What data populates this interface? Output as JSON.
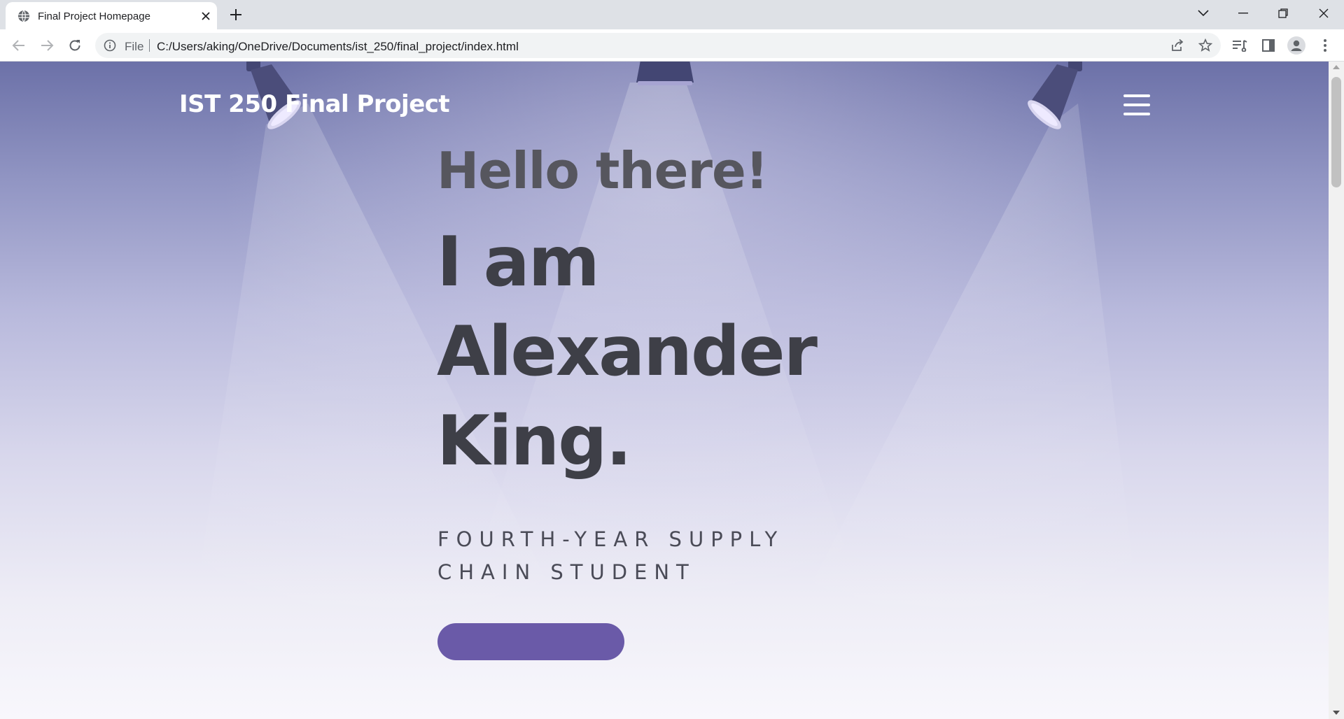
{
  "browser": {
    "tab_title": "Final Project Homepage",
    "omnibox": {
      "scheme_label": "File",
      "url": "C:/Users/aking/OneDrive/Documents/ist_250/final_project/index.html"
    },
    "icons": {
      "tab_favicon": "globe-icon",
      "tab_close": "close-icon",
      "new_tab": "plus-icon",
      "tab_search": "chevron-down-icon",
      "minimize": "minimize-icon",
      "restore": "restore-icon",
      "close_window": "close-icon",
      "back": "back-arrow-icon",
      "forward": "forward-arrow-icon",
      "reload": "reload-icon",
      "site_info": "info-icon",
      "share": "share-icon",
      "bookmark": "star-icon",
      "reading_list": "reading-list-icon",
      "side_panel": "side-panel-icon",
      "profile": "profile-icon",
      "menu": "kebab-menu-icon"
    }
  },
  "page": {
    "site_title": "IST 250 Final Project",
    "greeting": "Hello there!",
    "name_lines": [
      "I am",
      "Alexander",
      "King."
    ],
    "subtitle": "FOURTH-YEAR SUPPLY CHAIN STUDENT",
    "cta_label": "",
    "icons": {
      "nav_menu": "hamburger-menu-icon",
      "decor": "spotlight-icon"
    },
    "colors": {
      "title_text": "#ffffff",
      "greeting_text": "#56565e",
      "name_text": "#3e3f47",
      "subtitle_text": "#4a4b57",
      "cta_background": "#6a5aa8",
      "background_top": "#6c71a8",
      "background_bottom": "#f8f7fc"
    }
  }
}
